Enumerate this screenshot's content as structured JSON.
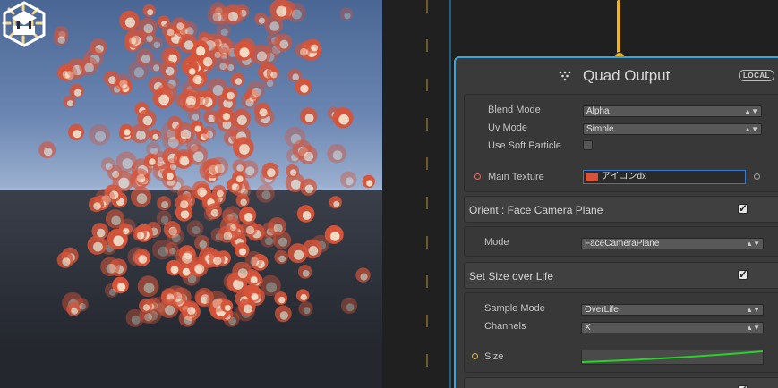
{
  "node": {
    "title": "Quad Output",
    "badge": "LOCAL",
    "output_settings": {
      "blend_mode_label": "Blend Mode",
      "blend_mode_value": "Alpha",
      "uv_mode_label": "Uv Mode",
      "uv_mode_value": "Simple",
      "soft_particle_label": "Use Soft Particle",
      "main_texture_label": "Main Texture",
      "main_texture_value": "アイコンdx"
    },
    "orient_block": {
      "title": "Orient : Face Camera Plane",
      "mode_label": "Mode",
      "mode_value": "FaceCameraPlane"
    },
    "size_block": {
      "title": "Set Size over Life",
      "sample_mode_label": "Sample Mode",
      "sample_mode_value": "OverLife",
      "channels_label": "Channels",
      "channels_value": "X",
      "size_label": "Size"
    }
  },
  "colors": {
    "node_border": "#3ba4d8",
    "wire": "#f0b323",
    "curve": "#27d327",
    "particle": "#d6543a"
  },
  "icons": {
    "sun": "sun-icon",
    "gizmo": "effect-gizmo-icon",
    "node": "particle-output-icon"
  }
}
